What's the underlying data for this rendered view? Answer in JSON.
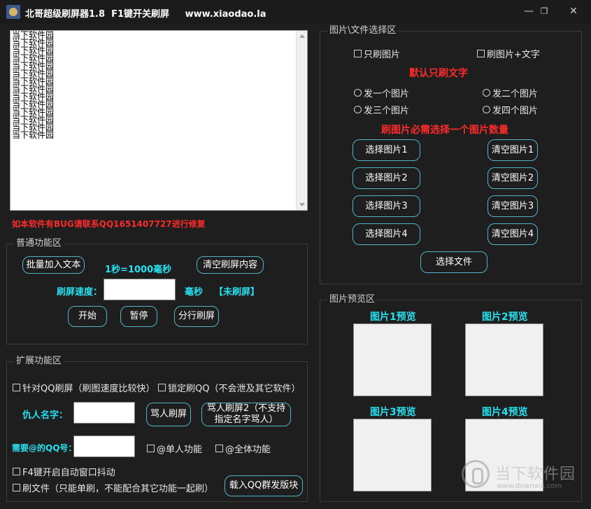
{
  "window": {
    "title": "北哥超级刷屏器1.8  F1键开关刷屏     www.xiaodao.la",
    "minimize": "—",
    "restore": "❐",
    "close": "✕"
  },
  "log": {
    "lines": [
      "当下软件园",
      "当下软件园",
      "当下软件园",
      "当下软件园",
      "当下软件园",
      "当下软件园",
      "当下软件园",
      "当下软件园",
      "当下软件园",
      "当下软件园",
      "当下软件园",
      "当下软件园",
      "当下软件园",
      "当下软件园"
    ]
  },
  "bug_notice": "如本软件有BUG请联系QQ1651407727进行修复",
  "basic": {
    "legend": "普通功能区",
    "batch_add": "批量加入文本",
    "time_hint": "1秒=1000毫秒",
    "clear_content": "清空刷屏内容",
    "speed_label": "刷屏速度：",
    "speed_value": "",
    "unit": "毫秒",
    "status": "【未刷屏】",
    "start": "开始",
    "pause": "暂停",
    "split": "分行刷屏"
  },
  "extended": {
    "legend": "扩展功能区",
    "qq_refresh": "针对QQ刷屏（刷图速度比较快）",
    "lock_qq": "锁定刷QQ（不会泄及其它软件）",
    "enemy_label": "仇人名字：",
    "enemy_value": "",
    "curse": "骂人刷屏",
    "curse2": "骂人刷屏2（不支持指定名字骂人）",
    "at_qq_label": "需要@的QQ号：",
    "at_qq_value": "",
    "at_single": "@单人功能",
    "at_all": "@全体功能",
    "f4_shake": "F4键开启自动窗口抖动",
    "file_refresh": "刷文件（只能单刷，不能配合其它功能一起刷）",
    "load_group": "载入QQ群发版块"
  },
  "select_area": {
    "legend": "图片\\文件选择区",
    "only_image": "只刷图片",
    "image_text": "刷图片+文字",
    "default_text": "默认只刷文字",
    "send1": "发一个图片",
    "send2": "发二个图片",
    "send3": "发三个图片",
    "send4": "发四个图片",
    "must_select": "刷图片必需选择一个图片数量",
    "select1": "选择图片1",
    "select2": "选择图片2",
    "select3": "选择图片3",
    "select4": "选择图片4",
    "clear1": "清空图片1",
    "clear2": "清空图片2",
    "clear3": "清空图片3",
    "clear4": "清空图片4",
    "select_file": "选择文件"
  },
  "preview_area": {
    "legend": "图片预览区",
    "p1": "图片1预览",
    "p2": "图片2预览",
    "p3": "图片3预览",
    "p4": "图片4预览"
  },
  "watermark": {
    "text": "当下软件园",
    "url": "www.downxia.com"
  },
  "colors": {
    "accent_red": "#ff2a2a",
    "accent_cyan": "#27e0f0",
    "button_border": "#4fb6c6"
  }
}
